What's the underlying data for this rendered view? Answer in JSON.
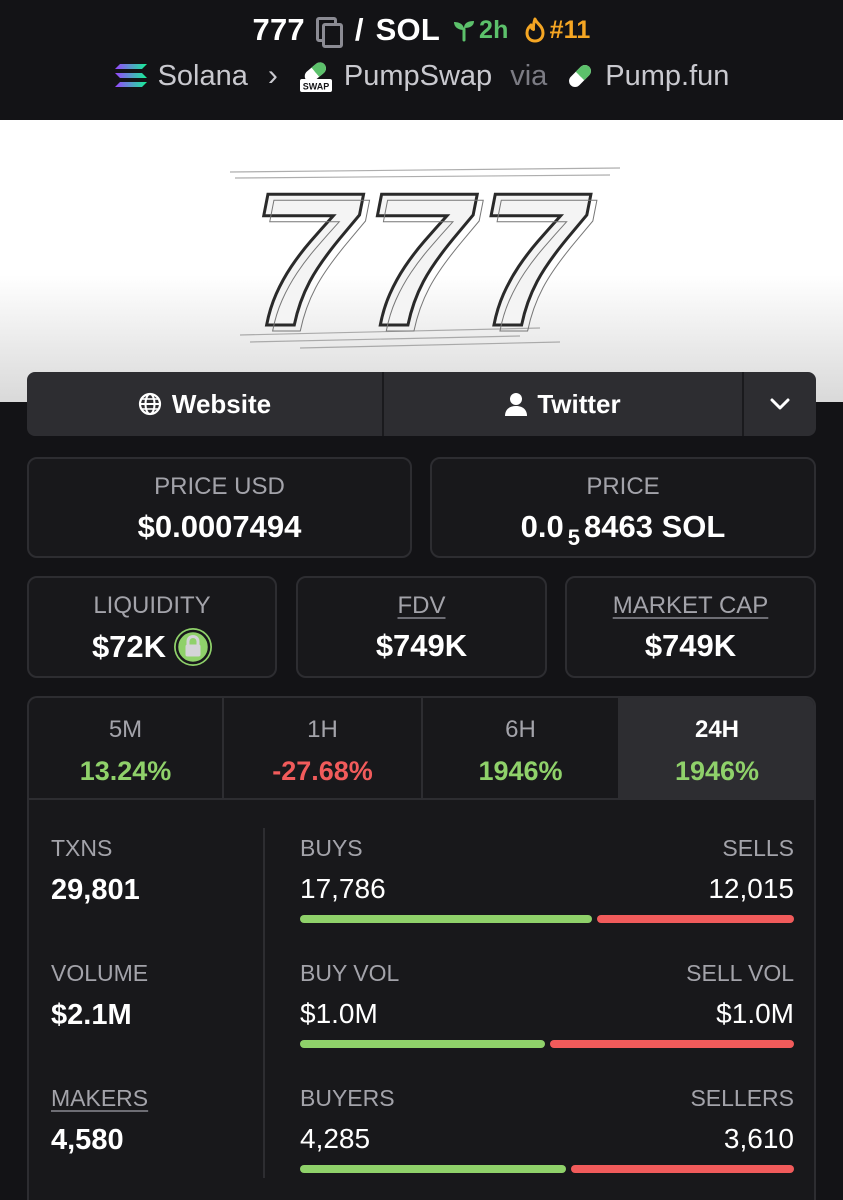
{
  "header": {
    "token_symbol": "777",
    "separator": "/",
    "quote_symbol": "SOL",
    "age": "2h",
    "rank": "#11",
    "chain": "Solana",
    "dex": "PumpSwap",
    "via_label": "via",
    "launchpad": "Pump.fun",
    "dex_badge_text": "SWAP"
  },
  "banner": {
    "text": "777"
  },
  "social": {
    "website_label": "Website",
    "twitter_label": "Twitter"
  },
  "price": {
    "usd_label": "PRICE USD",
    "usd_value": "$0.0007494",
    "native_label": "PRICE",
    "native_prefix": "0.0",
    "native_subscript": "5",
    "native_rest": "8463 SOL"
  },
  "metrics": {
    "liquidity_label": "LIQUIDITY",
    "liquidity_value": "$72K",
    "fdv_label": "FDV",
    "fdv_value": "$749K",
    "mcap_label": "MARKET CAP",
    "mcap_value": "$749K"
  },
  "timeframes": [
    {
      "label": "5M",
      "change": "13.24%",
      "direction": "up"
    },
    {
      "label": "1H",
      "change": "-27.68%",
      "direction": "down"
    },
    {
      "label": "6H",
      "change": "1946%",
      "direction": "up"
    },
    {
      "label": "24H",
      "change": "1946%",
      "direction": "up",
      "active": true
    }
  ],
  "stats": {
    "txns_label": "TXNS",
    "txns_value": "29,801",
    "volume_label": "VOLUME",
    "volume_value": "$2.1M",
    "makers_label": "MAKERS",
    "makers_value": "4,580",
    "buys_label": "BUYS",
    "buys_value": "17,786",
    "sells_label": "SELLS",
    "sells_value": "12,015",
    "buy_vol_label": "BUY VOL",
    "buy_vol_value": "$1.0M",
    "sell_vol_label": "SELL VOL",
    "sell_vol_value": "$1.0M",
    "buyers_label": "BUYERS",
    "buyers_value": "4,285",
    "sellers_label": "SELLERS",
    "sellers_value": "3,610",
    "buys_ratio": 0.597,
    "buy_vol_ratio": 0.5,
    "buyers_ratio": 0.543
  },
  "colors": {
    "positive": "#8fd16a",
    "negative": "#f15b5b",
    "background": "#131316",
    "card_border": "#2d2d31",
    "rank": "#f5a623",
    "age": "#5cc16b"
  }
}
